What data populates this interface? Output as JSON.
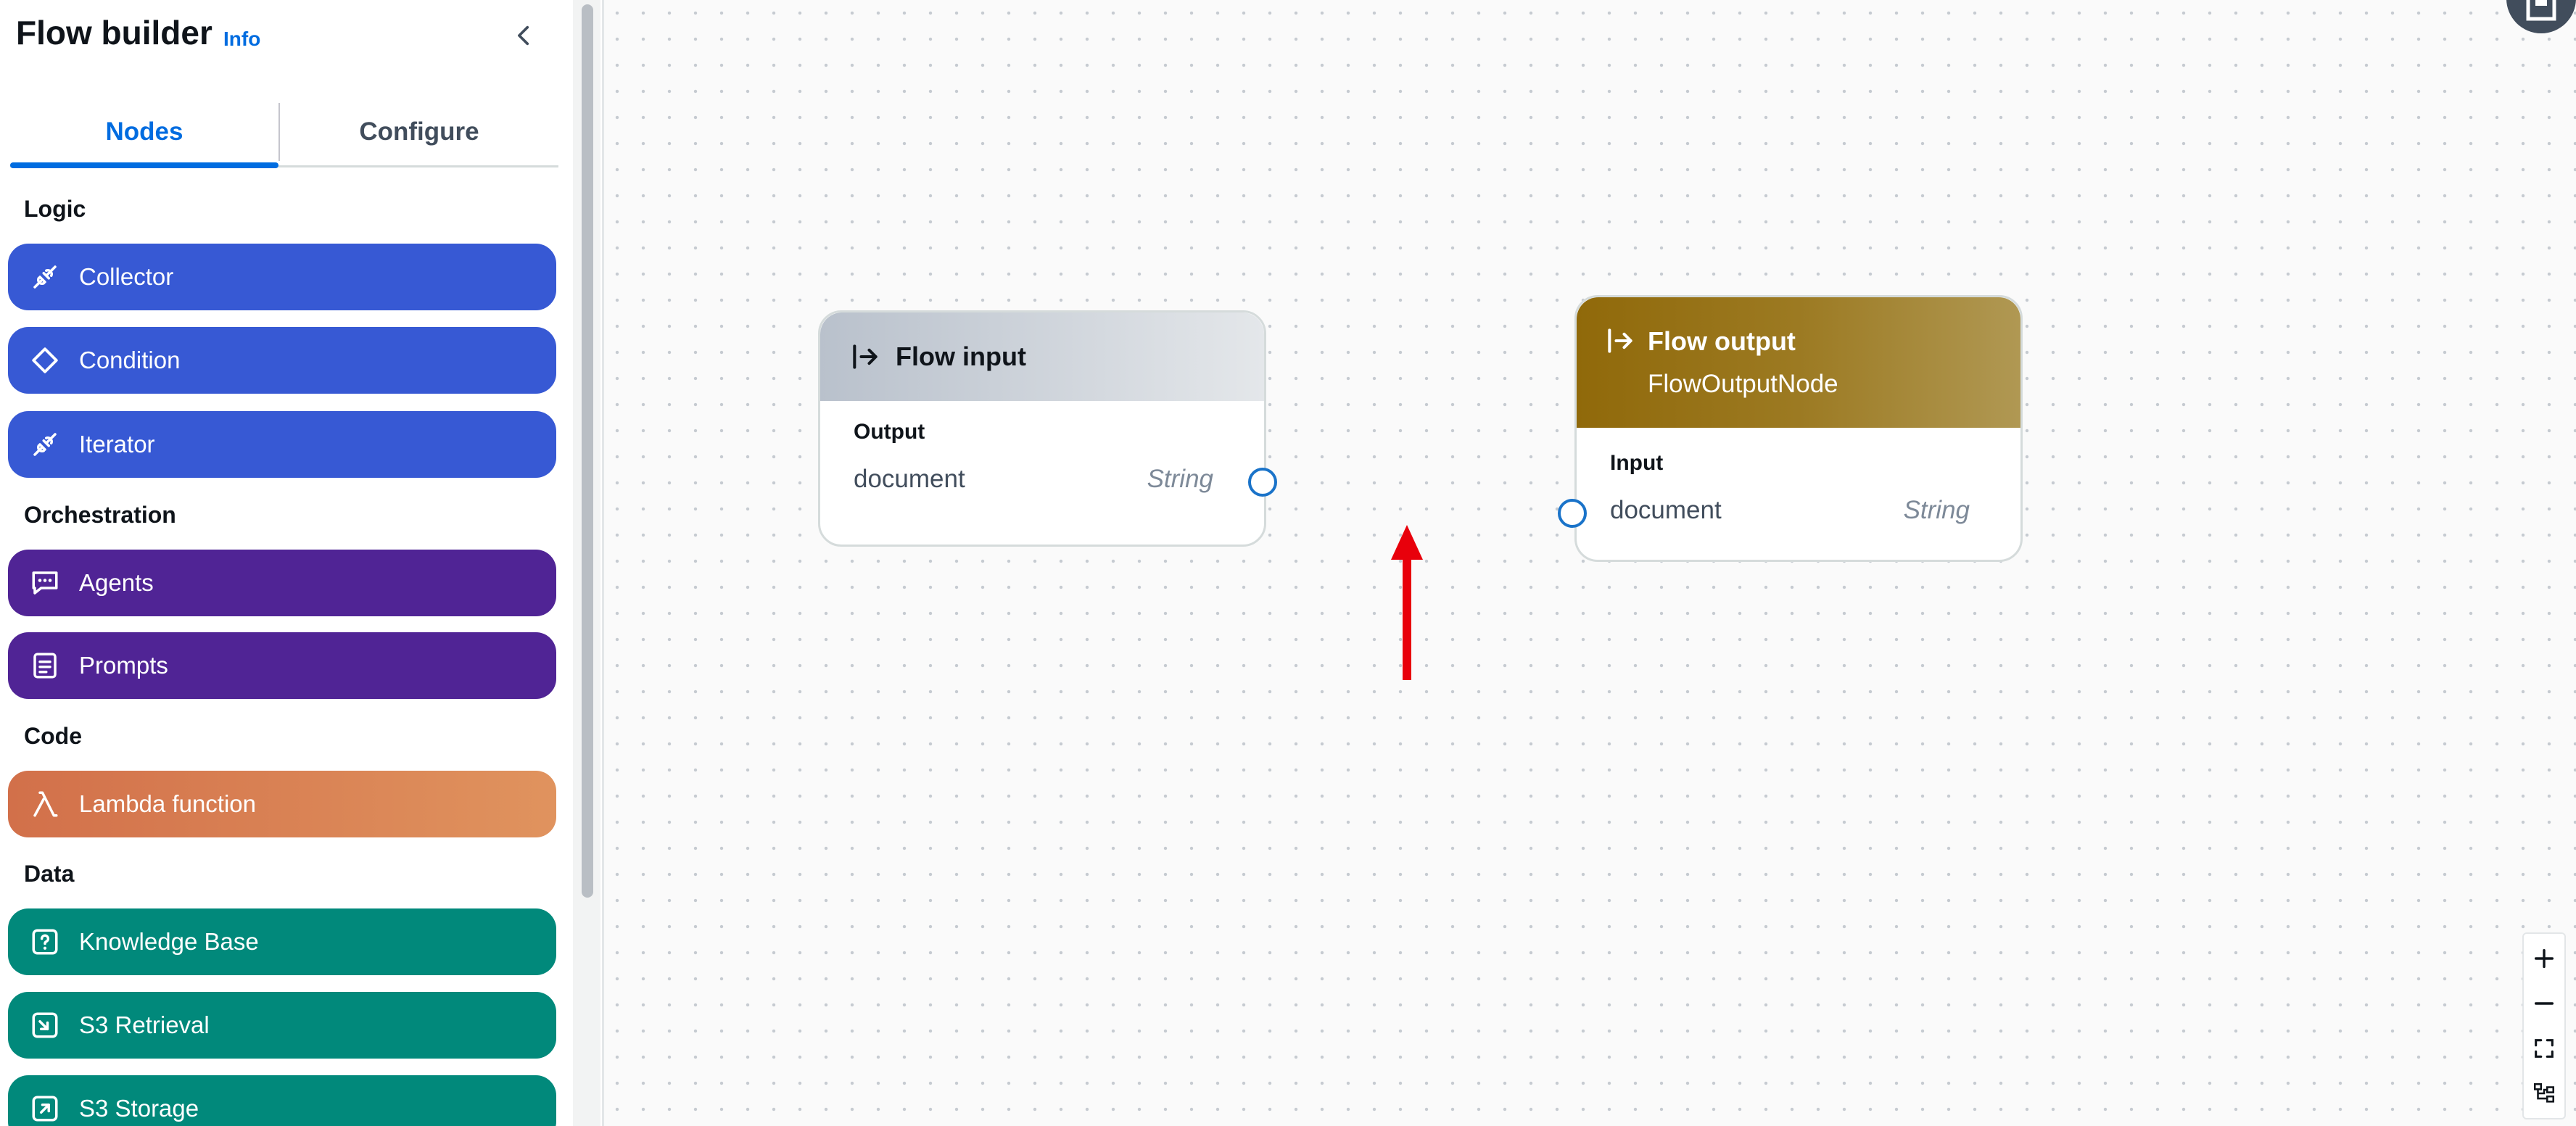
{
  "sidebar": {
    "title": "Flow builder",
    "info_link": "Info",
    "tabs": [
      {
        "label": "Nodes",
        "active": true
      },
      {
        "label": "Configure",
        "active": false
      }
    ],
    "sections": [
      {
        "label": "Logic"
      },
      {
        "label": "Orchestration"
      },
      {
        "label": "Code"
      },
      {
        "label": "Data"
      }
    ],
    "nodes": {
      "collector": {
        "label": "Collector",
        "icon": "collector-icon",
        "color": "#3759d4"
      },
      "condition": {
        "label": "Condition",
        "icon": "condition-diamond-icon",
        "color": "#3759d4"
      },
      "iterator": {
        "label": "Iterator",
        "icon": "iterator-icon",
        "color": "#3759d4"
      },
      "agents": {
        "label": "Agents",
        "icon": "chat-bubble-icon",
        "color": "#502495"
      },
      "prompts": {
        "label": "Prompts",
        "icon": "document-lines-icon",
        "color": "#502495"
      },
      "lambda": {
        "label": "Lambda function",
        "icon": "lambda-icon",
        "color": "#d2704a"
      },
      "knowledge_base": {
        "label": "Knowledge Base",
        "icon": "question-box-icon",
        "color": "#01897b"
      },
      "s3_retrieval": {
        "label": "S3 Retrieval",
        "icon": "s3-retrieve-icon",
        "color": "#01897b"
      },
      "s3_storage": {
        "label": "S3 Storage",
        "icon": "s3-store-icon",
        "color": "#01897b"
      }
    }
  },
  "canvas": {
    "flow_input": {
      "title": "Flow input",
      "section_label": "Output",
      "port_name": "document",
      "port_type": "String"
    },
    "flow_output": {
      "title": "Flow output",
      "subtitle": "FlowOutputNode",
      "section_label": "Input",
      "port_name": "document",
      "port_type": "String"
    },
    "annotation_arrow_color": "#e8000b",
    "zoom_controls": [
      "zoom-in-icon",
      "zoom-out-icon",
      "fit-view-icon",
      "auto-layout-icon"
    ]
  }
}
